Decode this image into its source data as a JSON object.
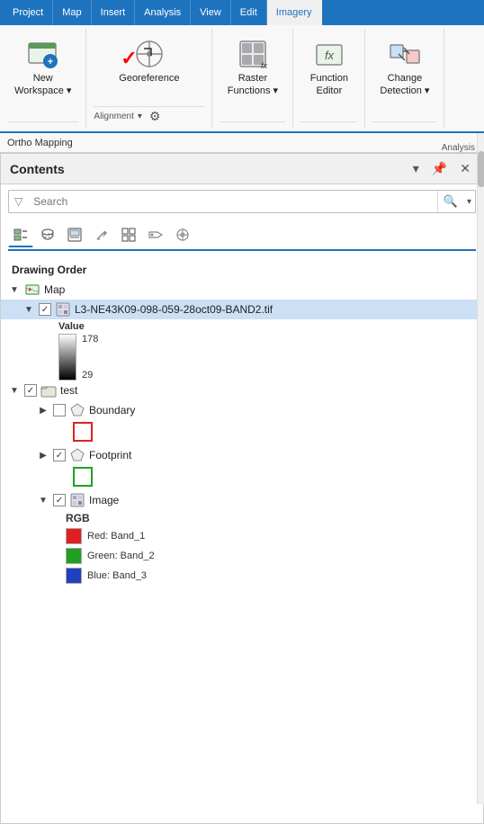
{
  "ribbon": {
    "tabs": [
      "Project",
      "Map",
      "Insert",
      "Analysis",
      "View",
      "Edit",
      "Imagery"
    ],
    "active_tab": "Imagery",
    "ortho_mapping_label": "Ortho Mapping",
    "groups": [
      {
        "id": "new-workspace",
        "label": "New\nWorkspace",
        "icon": "🗺",
        "has_dropdown": true
      },
      {
        "id": "georeference",
        "label": "Georeference",
        "icon": "⊕",
        "subgroups": [
          {
            "id": "alignment",
            "label": "Alignment",
            "has_dropdown": true
          }
        ]
      },
      {
        "id": "raster-functions",
        "label": "Raster\nFunctions",
        "icon": "fx",
        "has_dropdown": true
      },
      {
        "id": "function-editor",
        "label": "Function\nEditor",
        "icon": "fx"
      },
      {
        "id": "change-detection",
        "label": "Change\nDetection",
        "icon": "⇌",
        "has_dropdown": true
      }
    ],
    "analysis_label": "Analysis"
  },
  "contents": {
    "title": "Contents",
    "search_placeholder": "Search",
    "toolbar_icons": [
      {
        "id": "list-by-drawing-order",
        "icon": "≡",
        "label": "List by drawing order",
        "active": true
      },
      {
        "id": "list-by-source",
        "icon": "🗄",
        "label": "List by source"
      },
      {
        "id": "list-by-selection",
        "icon": "◧",
        "label": "List by selection"
      },
      {
        "id": "edit-icon",
        "icon": "✏",
        "label": "Edit"
      },
      {
        "id": "create-chart",
        "icon": "⊞",
        "label": "Create chart"
      },
      {
        "id": "label-icon",
        "icon": "🏷",
        "label": "Label"
      },
      {
        "id": "feature-icon",
        "icon": "⊗",
        "label": "Feature"
      }
    ],
    "drawing_order_label": "Drawing Order",
    "layers": [
      {
        "id": "map",
        "label": "Map",
        "type": "map",
        "level": 1,
        "expanded": true,
        "checked": null,
        "children": [
          {
            "id": "raster-band2",
            "label": "L3-NE43K09-098-059-28oct09-BAND2.tif",
            "type": "raster",
            "level": 2,
            "expanded": true,
            "checked": true,
            "selected": true,
            "children": [
              {
                "id": "raster-legend",
                "type": "legend",
                "value_label": "Value",
                "max_value": "178",
                "min_value": "29"
              }
            ]
          }
        ]
      },
      {
        "id": "test",
        "label": "test",
        "type": "group",
        "level": 1,
        "expanded": true,
        "checked": true,
        "children": [
          {
            "id": "boundary",
            "label": "Boundary",
            "type": "polygon",
            "level": 3,
            "expanded": false,
            "checked": false,
            "children": [
              {
                "id": "boundary-symbol",
                "type": "symbol-red-outline"
              }
            ]
          },
          {
            "id": "footprint",
            "label": "Footprint",
            "type": "polygon",
            "level": 3,
            "expanded": false,
            "checked": true,
            "children": [
              {
                "id": "footprint-symbol",
                "type": "symbol-green-outline"
              }
            ]
          },
          {
            "id": "image",
            "label": "Image",
            "type": "raster",
            "level": 3,
            "expanded": true,
            "checked": true,
            "children": [
              {
                "id": "image-legend",
                "type": "rgb-legend",
                "rgb_label": "RGB",
                "channels": [
                  {
                    "color": "#e02020",
                    "label": "Red:   Band_1"
                  },
                  {
                    "color": "#20a020",
                    "label": "Green: Band_2"
                  },
                  {
                    "color": "#2040c0",
                    "label": "Blue:  Band_3"
                  }
                ]
              }
            ]
          }
        ]
      }
    ]
  }
}
